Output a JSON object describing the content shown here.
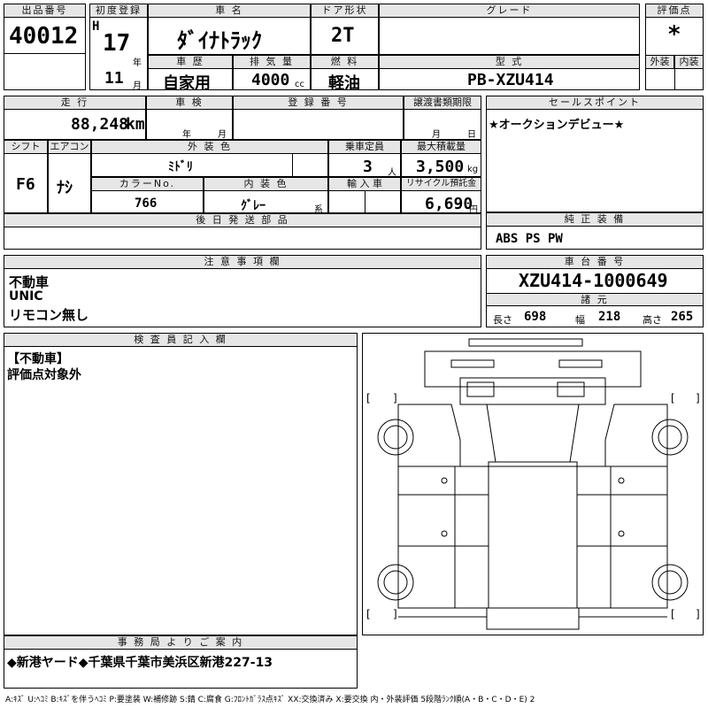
{
  "headers": {
    "lot_no": "出品番号",
    "first_reg": "初度登録",
    "car_name": "車 名",
    "door": "ドア形状",
    "grade": "グレード",
    "score": "評価点",
    "history": "車 歴",
    "displacement": "排 気 量",
    "fuel": "燃 料",
    "model_type": "型 式",
    "exterior": "外装",
    "interior": "内装",
    "mileage": "走 行",
    "inspection": "車 検",
    "registration_no": "登 録 番 号",
    "transfer_deadline": "譲渡書類期限",
    "shift": "シフト",
    "aircon": "エアコン",
    "exterior_color": "外 装 色",
    "capacity": "乗車定員",
    "max_load": "最大積載量",
    "color_no": "カラーNo.",
    "interior_color": "内 装 色",
    "import": "輸 入 車",
    "recycle": "リサイクル預託金",
    "delivered_later": "後 日 発 送 部 品",
    "sales_points": "セールスポイント",
    "genuine_equipment": "純 正 装 備",
    "caution": "注 意 事 項 欄",
    "chassis_no": "車 台 番 号",
    "specs": "諸 元",
    "inspector": "検 査 員 記 入 欄",
    "office_info": "事 務 局 よ り ご 案 内"
  },
  "values": {
    "lot_no": "40012",
    "era_letter": "H",
    "year": "17",
    "year_unit": "年",
    "month": "11",
    "month_unit": "月",
    "car_name": "ﾀﾞｲﾅﾄﾗｯｸ",
    "door": "2T",
    "score": "*",
    "history": "自家用",
    "displacement": "4000",
    "displacement_unit": "cc",
    "fuel": "軽油",
    "model_type": "PB-XZU414",
    "mileage": "88,248",
    "mileage_unit": "km",
    "insp_year_unit": "年",
    "insp_month_unit": "月",
    "transfer_month_unit": "月",
    "transfer_day_unit": "日",
    "shift": "F6",
    "aircon": "ﾅｼ",
    "exterior_color": "ﾐﾄﾞﾘ",
    "capacity": "3",
    "capacity_unit": "人",
    "max_load": "3,500",
    "max_load_unit": "kg",
    "color_no": "766",
    "interior_color": "ｸﾞﾚｰ",
    "interior_color_suffix": "系",
    "recycle": "6,690",
    "recycle_unit": "円",
    "sales_point": "★オークションデビュー★",
    "genuine_equipment": "ABS PS PW",
    "caution_line1": "不動車",
    "caution_line2": "UNIC",
    "caution_line3": "リモコン無し",
    "chassis_no": "XZU414-1000649",
    "length_label": "長さ",
    "length": "698",
    "width_label": "幅",
    "width": "218",
    "height_label": "高さ",
    "height": "265",
    "inspector_line1": "【不動車】",
    "inspector_line2": "評価点対象外",
    "office_text": "◆新港ヤード◆千葉県千葉市美浜区新港227-13",
    "bracket_open": "[",
    "bracket_close": "]"
  },
  "footer": "A:ｷｽﾞ U:ﾍｺﾐ B:ｷｽﾞを伴うﾍｺﾐ P:要塗装 W:補修跡 S:錆 C:腐食 G:ﾌﾛﾝﾄｶﾞﾗｽ点ｷｽﾞ XX:交換済み X:要交換 内・外装評価 5段階ﾗﾝｸ順(A・B・C・D・E) 2"
}
